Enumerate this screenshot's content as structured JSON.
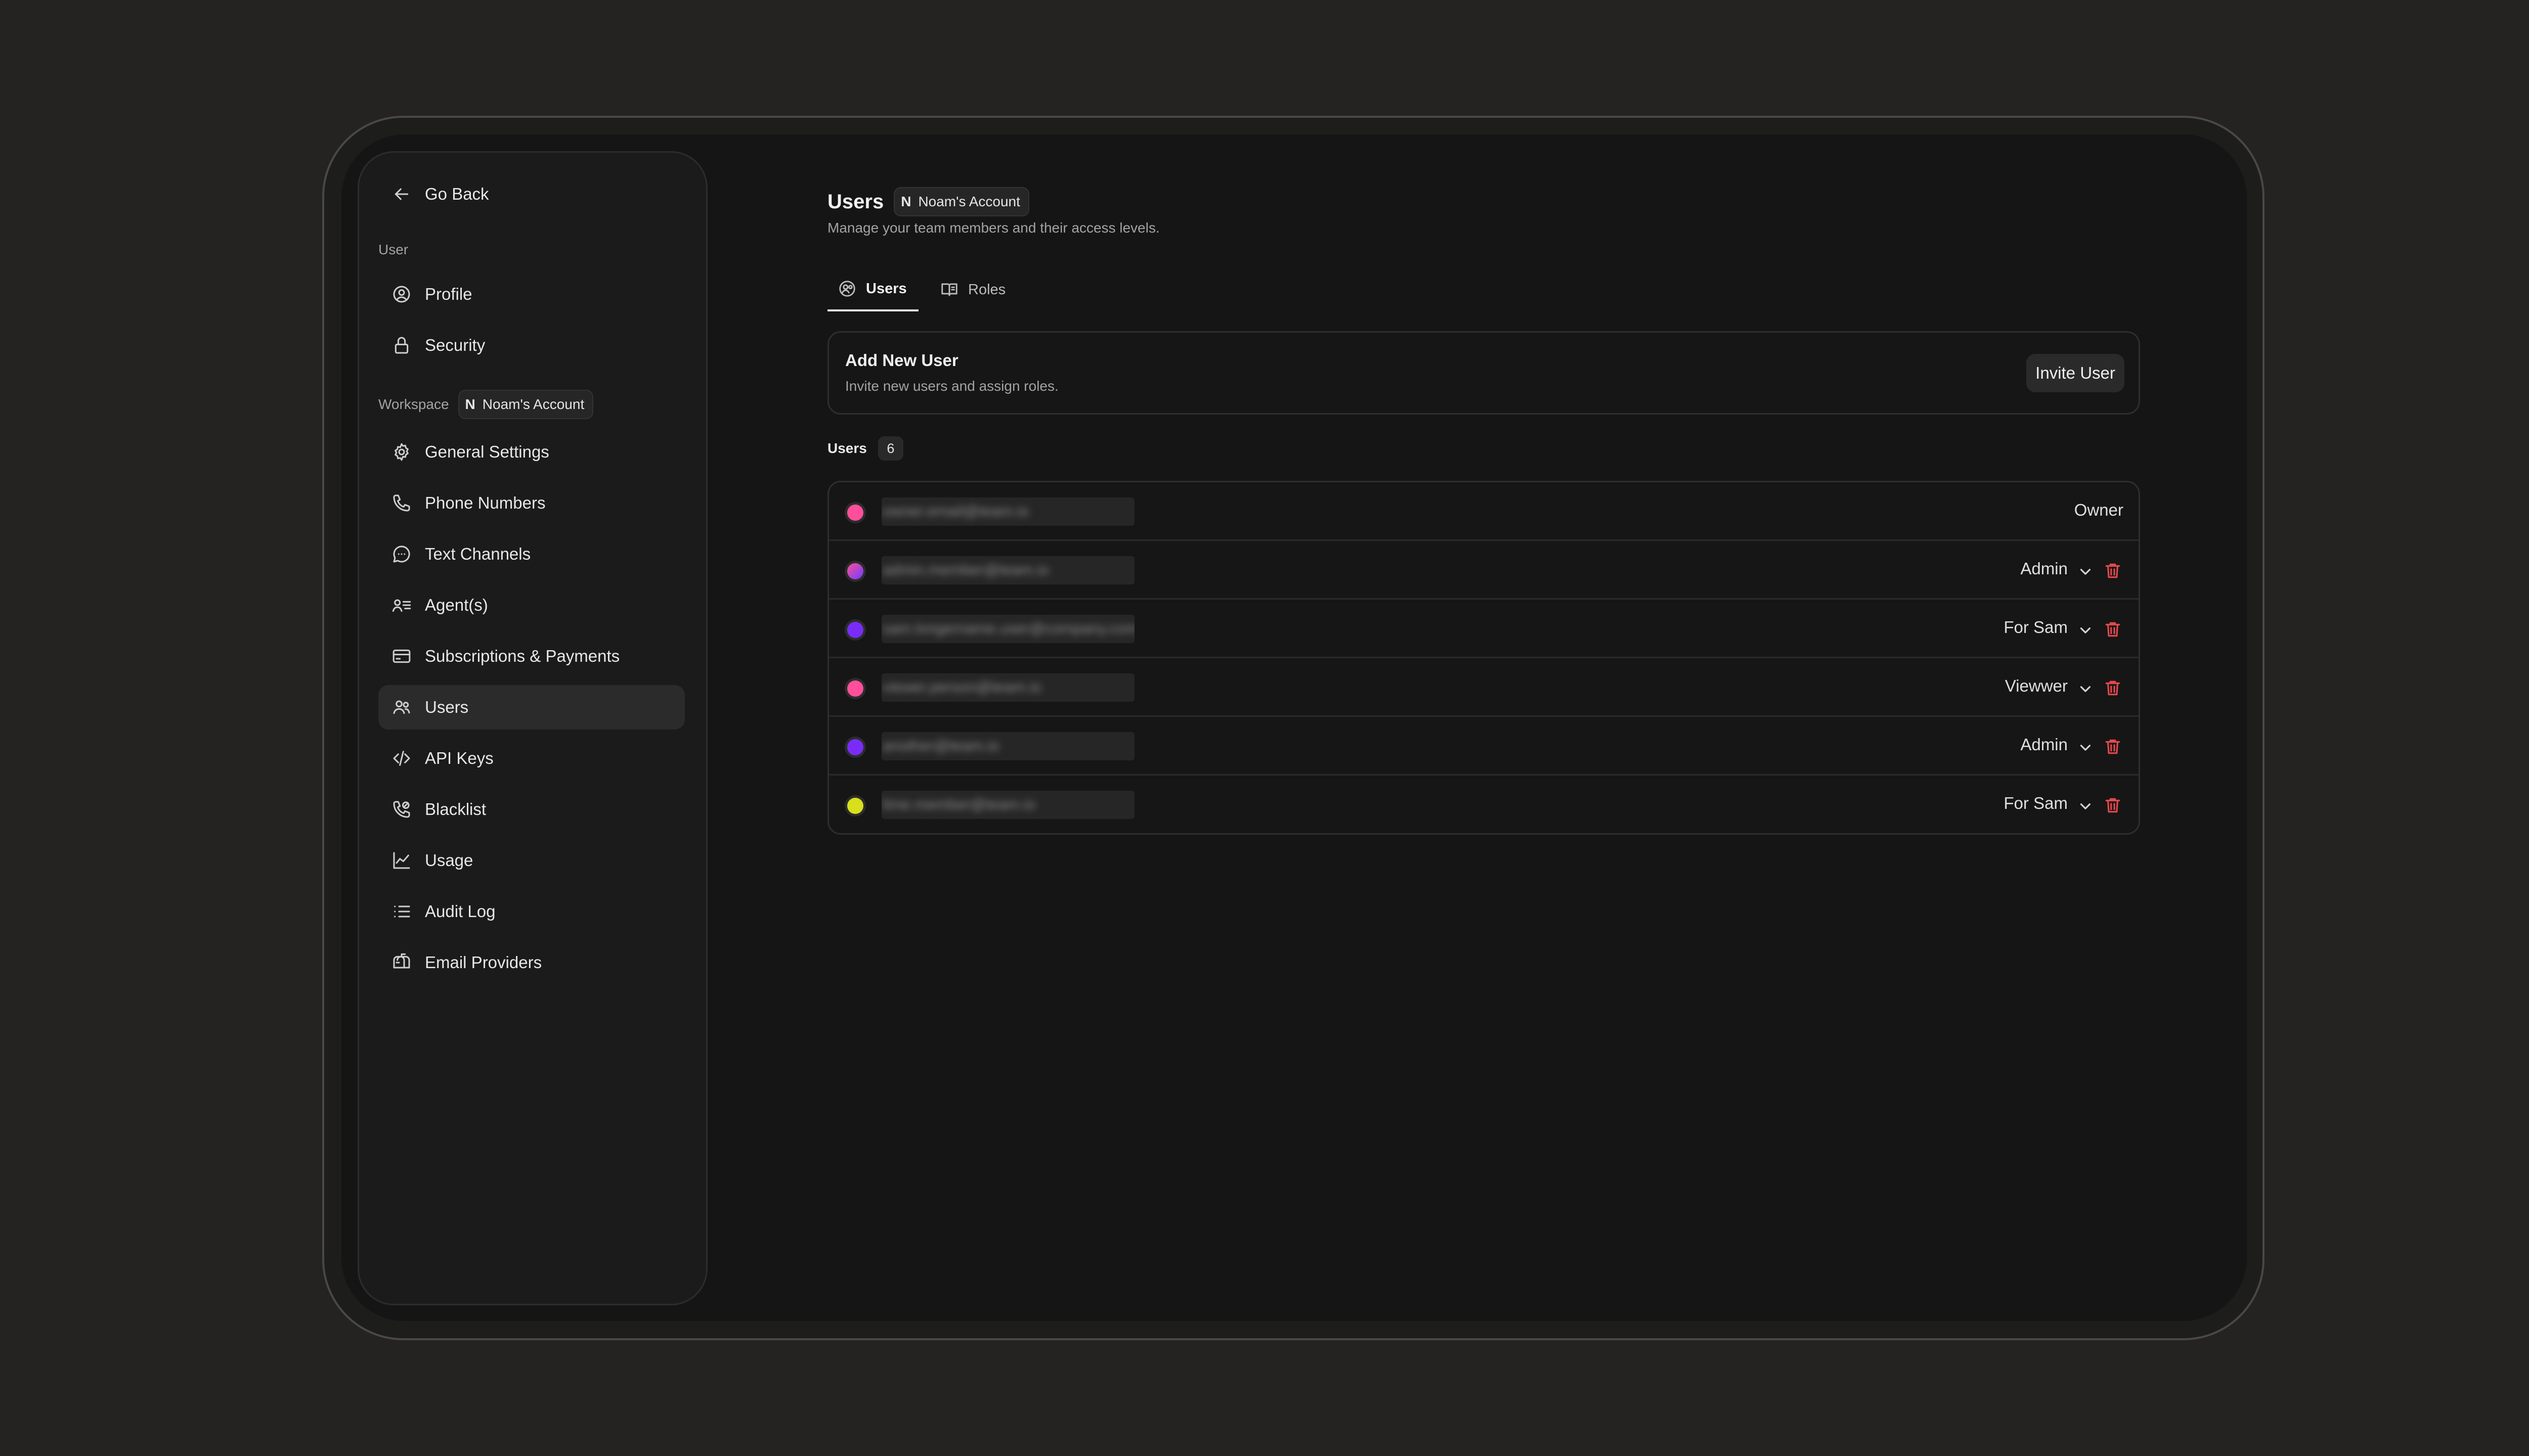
{
  "sidebar": {
    "back_label": "Go Back",
    "user_section": "User",
    "workspace_section": "Workspace",
    "workspace_badge": {
      "letter": "N",
      "name": "Noam's Account"
    },
    "items": [
      {
        "label": "Profile",
        "icon": "user-circle-icon"
      },
      {
        "label": "Security",
        "icon": "lock-icon"
      },
      {
        "label": "General Settings",
        "icon": "gear-icon"
      },
      {
        "label": "Phone Numbers",
        "icon": "phone-icon"
      },
      {
        "label": "Text Channels",
        "icon": "chat-bubble-icon"
      },
      {
        "label": "Agent(s)",
        "icon": "agent-list-icon"
      },
      {
        "label": "Subscriptions & Payments",
        "icon": "credit-card-icon"
      },
      {
        "label": "Users",
        "icon": "users-icon",
        "active": true
      },
      {
        "label": "API Keys",
        "icon": "code-icon"
      },
      {
        "label": "Blacklist",
        "icon": "phone-blocked-icon"
      },
      {
        "label": "Usage",
        "icon": "line-chart-icon"
      },
      {
        "label": "Audit Log",
        "icon": "list-icon"
      },
      {
        "label": "Email Providers",
        "icon": "mailbox-icon"
      }
    ]
  },
  "header": {
    "title": "Users",
    "account_badge": {
      "letter": "N",
      "name": "Noam's Account"
    },
    "subtitle": "Manage your team members and their access levels."
  },
  "tabs": [
    {
      "label": "Users",
      "icon": "users-circle-icon",
      "active": true
    },
    {
      "label": "Roles",
      "icon": "book-icon"
    }
  ],
  "add_user": {
    "title": "Add New User",
    "description": "Invite new users and assign roles.",
    "button_label": "Invite User"
  },
  "users_section": {
    "label": "Users",
    "count": "6"
  },
  "users": [
    {
      "email": "owner.email@team.io",
      "role": "Owner",
      "editable": false,
      "color": "#ff4f9a"
    },
    {
      "email": "admin.member@team.io",
      "role": "Admin",
      "editable": true,
      "color": "#a04cff"
    },
    {
      "email": "sam.longername.user@company.com",
      "role": "For Sam",
      "editable": true,
      "color": "#7a2cf7"
    },
    {
      "email": "viewer.person@team.io",
      "role": "Viewwer",
      "editable": true,
      "color": "#ff4f9a"
    },
    {
      "email": "another@team.io",
      "role": "Admin",
      "editable": true,
      "color": "#7a2cf7"
    },
    {
      "email": "lime.member@team.io",
      "role": "For Sam",
      "editable": true,
      "color": "#d8e01b"
    }
  ]
}
